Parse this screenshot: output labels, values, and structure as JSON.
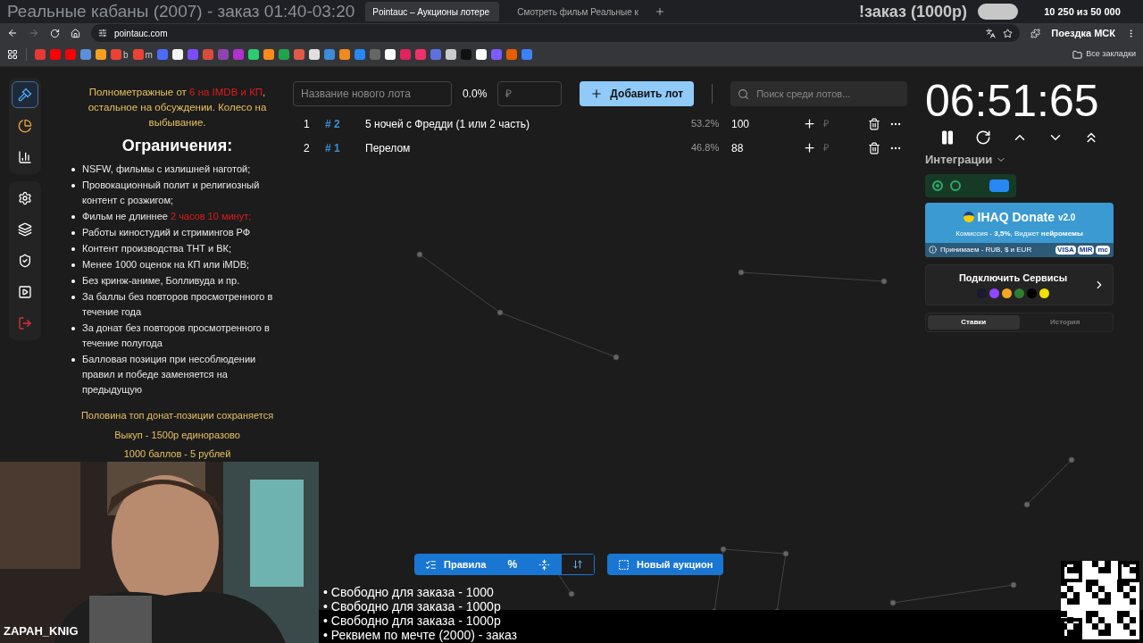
{
  "stream_overlay": {
    "title": "Реальные кабаны (2007) - заказ 01:40-03:20",
    "order": "!заказ (1000р)",
    "goal": "10 250  из 50 000",
    "goal_bar": {
      "level": 1
    },
    "goal_name": "Поездка МСК",
    "webcam_name": "ZAPAH_KNIG",
    "lines": [
      "• Свободно для заказа - 1000",
      "• Свободно для заказа - 1000р",
      "• Свободно для заказа - 1000р",
      "• Реквием по мечте (2000) - заказ"
    ]
  },
  "browser": {
    "tabs": [
      {
        "title": "Pointauc – Аукционы лотере",
        "selected": true
      },
      {
        "title": "Смотреть фильм Реальные к",
        "selected": false
      }
    ],
    "url": "pointauc.com",
    "all_bookmarks": "Все закладки",
    "bookmarks": [
      {
        "color": "#e53935"
      },
      {
        "color": "#ff0000"
      },
      {
        "color": "#ff0000"
      },
      {
        "color": "#5c8fd6"
      },
      {
        "color": "#f4a020"
      },
      {
        "color": "#ea4335",
        "label": "b"
      },
      {
        "color": "#ea4335",
        "label": "m"
      },
      {
        "color": "#4a6cf7"
      },
      {
        "color": "#f5f5f5"
      },
      {
        "color": "#7b4dff"
      },
      {
        "color": "#d84c3c"
      },
      {
        "color": "#8e44ad"
      },
      {
        "color": "#b030d0"
      },
      {
        "color": "#2ecc71"
      },
      {
        "color": "#ff8a1c"
      },
      {
        "color": "#22a34a"
      },
      {
        "color": "#e05a47"
      },
      {
        "color": "#e0e0e0"
      },
      {
        "color": "#3d8bdb"
      },
      {
        "color": "#f08a1c"
      },
      {
        "color": "#2787f5"
      },
      {
        "color": "#666666"
      },
      {
        "color": "#ffffff"
      },
      {
        "color": "#e0245e"
      },
      {
        "color": "#f0306a"
      },
      {
        "color": "#6070e0"
      },
      {
        "color": "#cccccc"
      },
      {
        "color": "#111111"
      },
      {
        "color": "#ffffff"
      },
      {
        "color": "#7b5cff"
      },
      {
        "color": "#e85d04"
      },
      {
        "color": "#3b82f6"
      }
    ]
  },
  "sidebar": {
    "groups": [
      [
        {
          "kind": "auction",
          "selected": true
        },
        {
          "kind": "wheel",
          "selected": false
        },
        {
          "kind": "stats",
          "selected": false
        }
      ],
      [
        {
          "kind": "settings",
          "selected": false
        },
        {
          "kind": "layers",
          "selected": false
        },
        {
          "kind": "shield",
          "selected": false
        },
        {
          "kind": "video",
          "selected": false
        },
        {
          "kind": "logout",
          "selected": false
        }
      ]
    ]
  },
  "rules": {
    "intro": [
      {
        "text": "Полнометражные от ",
        "highlight": false
      },
      {
        "text": "6 на IMDB и КП",
        "highlight": true
      },
      {
        "text": ", остальное на обсуждении. Колесо на выбывание.",
        "highlight": false
      }
    ],
    "heading": "Ограничения:",
    "items": [
      [
        {
          "text": "NSFW, фильмы с излишней наготой;",
          "highlight": false
        }
      ],
      [
        {
          "text": "Провокационный полит и религиозный контент с розжигом;",
          "highlight": false
        }
      ],
      [
        {
          "text": "Фильм не длиннее ",
          "highlight": false
        },
        {
          "text": "2 часов 10 минут;",
          "highlight": true
        }
      ],
      [
        {
          "text": "Работы киностудий и стримингов РФ",
          "highlight": false
        }
      ],
      [
        {
          "text": "Контент производства ТНТ и ВК;",
          "highlight": false
        }
      ],
      [
        {
          "text": "Менее 1000 оценок на КП или iMDB;",
          "highlight": false
        }
      ],
      [
        {
          "text": "Без кринж-аниме, Болливуда и пр.",
          "highlight": false
        }
      ],
      [
        {
          "text": "За баллы без повторов просмотренного в течение года",
          "highlight": false
        }
      ],
      [
        {
          "text": "За донат без повторов просмотренного в течение полугода",
          "highlight": false
        }
      ],
      [
        {
          "text": "Балловая позиция при несоблюдении правил и победе заменяется на предыдущую",
          "highlight": false
        }
      ]
    ],
    "footer": [
      "Половина топ донат-позиции сохраняется",
      "Выкуп - 1500р единоразово",
      "1000 баллов - 5 рублей"
    ]
  },
  "lot_form": {
    "name_placeholder": "Название нового лота",
    "percent": "0.0%",
    "price_placeholder": "₽",
    "add_button": "Добавить лот",
    "search_placeholder": "Поиск среди лотов..."
  },
  "lots": [
    {
      "index": "1",
      "id": "# 2",
      "name": "5 ночей с Фредди (1 или 2 часть)",
      "percent": "53.2%",
      "amount": "100",
      "price_placeholder": "₽"
    },
    {
      "index": "2",
      "id": "# 1",
      "name": "Перелом",
      "percent": "46.8%",
      "amount": "88",
      "price_placeholder": "₽"
    }
  ],
  "timer": "06:51:65",
  "integrations": {
    "title": "Интеграции",
    "toggles": [
      {
        "on": true
      },
      {
        "on": false
      }
    ],
    "donate": {
      "title": "IHAQ Donate",
      "version": "v2.0",
      "info": "Комиссия - **3,5%**, Виджет **нейромемы**",
      "accepts": "Принимаем - RUB, $ и EUR",
      "cards": [
        "VISA",
        "MIR",
        "mc"
      ]
    },
    "connect": {
      "title": "Подключить Сервисы",
      "services": [
        {
          "color": "#1a1a2e"
        },
        {
          "color": "#9146ff"
        },
        {
          "color": "#f5a623"
        },
        {
          "color": "#2e7d32"
        },
        {
          "color": "#000000"
        },
        {
          "color": "#f5e000"
        }
      ]
    }
  },
  "panel_tabs": [
    {
      "label": "Ставки",
      "selected": true
    },
    {
      "label": "История",
      "selected": false
    }
  ],
  "toolbar": {
    "rules": "Правила",
    "percent": "%",
    "new_auction": "Новый аукцион"
  }
}
